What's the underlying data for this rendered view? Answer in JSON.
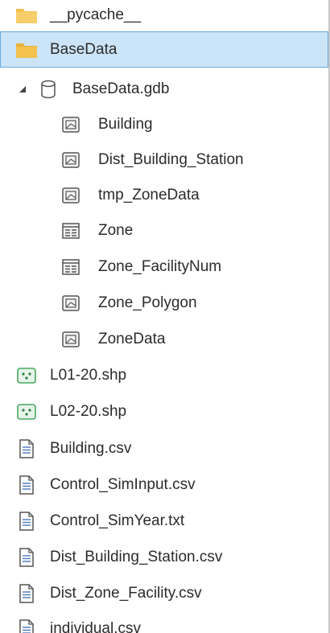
{
  "tree": {
    "pycache": {
      "label": "__pycache__"
    },
    "basedata_folder": {
      "label": "BaseData"
    },
    "gdb": {
      "label": "BaseData.gdb"
    },
    "gdb_items": [
      {
        "label": "Building",
        "icon": "feature-class-icon"
      },
      {
        "label": "Dist_Building_Station",
        "icon": "feature-class-icon"
      },
      {
        "label": "tmp_ZoneData",
        "icon": "feature-class-icon"
      },
      {
        "label": "Zone",
        "icon": "table-icon"
      },
      {
        "label": "Zone_FacilityNum",
        "icon": "table-icon"
      },
      {
        "label": "Zone_Polygon",
        "icon": "feature-class-icon"
      },
      {
        "label": "ZoneData",
        "icon": "feature-class-icon"
      }
    ],
    "shapefiles": [
      {
        "label": "L01-20.shp",
        "icon": "point-shapefile-icon"
      },
      {
        "label": "L02-20.shp",
        "icon": "point-shapefile-icon"
      }
    ],
    "files": [
      {
        "label": "Building.csv",
        "icon": "text-file-icon"
      },
      {
        "label": "Control_SimInput.csv",
        "icon": "text-file-icon"
      },
      {
        "label": "Control_SimYear.txt",
        "icon": "text-file-icon"
      },
      {
        "label": "Dist_Building_Station.csv",
        "icon": "text-file-icon"
      },
      {
        "label": "Dist_Zone_Facility.csv",
        "icon": "text-file-icon"
      },
      {
        "label": "individual.csv",
        "icon": "text-file-icon"
      }
    ]
  },
  "colors": {
    "selection_background": "#cce4f7",
    "selection_border": "#69a8dc",
    "folder": "#f2c14e",
    "point_shapefile": "#47a85f"
  }
}
